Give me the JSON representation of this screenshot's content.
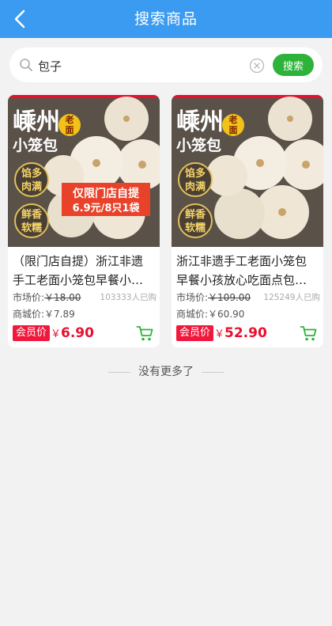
{
  "header": {
    "title": "搜索商品",
    "back_icon": "chevron-left-icon"
  },
  "search": {
    "value": "包子",
    "button_label": "搜索"
  },
  "products": [
    {
      "title_line1": "（限门店自提）浙江非遗",
      "title_line2": "手工老面小笼包早餐小…",
      "market_label": "市场价:",
      "market_price": "￥18.00",
      "sold": "103333人已购",
      "mall_label": "商城价:",
      "mall_price": "￥7.89",
      "member_label": "会员价",
      "currency": "￥",
      "member_price": "6.90",
      "image": {
        "headline1": "嵊州",
        "headline2": "小笼包",
        "badge_top": "老",
        "badge_bottom": "面",
        "seal1_top": "馅多",
        "seal1_bottom": "肉满",
        "seal2_top": "鲜香",
        "seal2_bottom": "软糯",
        "promo_line1": "仅限门店自提",
        "promo_line2": "6.9元/8只1袋"
      }
    },
    {
      "title_line1": "浙江非遗手工老面小笼包",
      "title_line2": "早餐小孩放心吃面点包…",
      "market_label": "市场价:",
      "market_price": "￥109.00",
      "sold": "125249人已购",
      "mall_label": "商城价:",
      "mall_price": "￥60.90",
      "member_label": "会员价",
      "currency": "￥",
      "member_price": "52.90",
      "image": {
        "headline1": "嵊州",
        "headline2": "小笼包",
        "badge_top": "老",
        "badge_bottom": "面",
        "seal1_top": "馅多",
        "seal1_bottom": "肉满",
        "seal2_top": "鲜香",
        "seal2_bottom": "软糯"
      }
    }
  ],
  "footer": {
    "no_more": "没有更多了"
  },
  "colors": {
    "header": "#3a9bf0",
    "search_button": "#2db33a",
    "member_badge": "#f0193c",
    "price": "#e8102e",
    "cart": "#2db33a"
  }
}
